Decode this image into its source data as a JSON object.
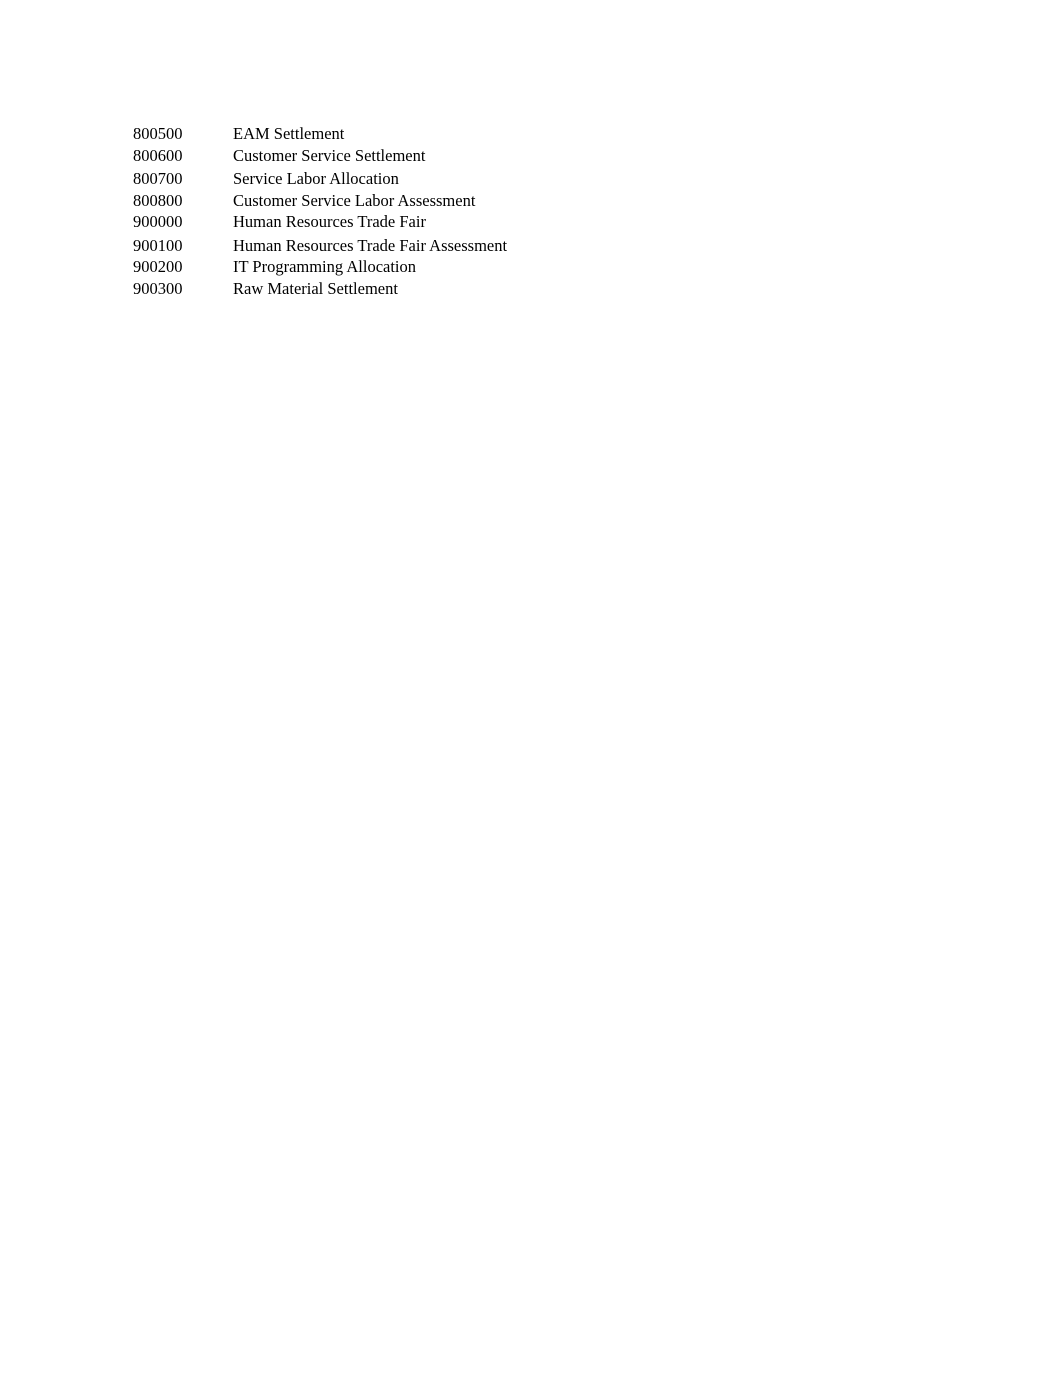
{
  "document": {
    "rows": [
      {
        "code": "800500",
        "description": "EAM Settlement"
      },
      {
        "code": "800600",
        "description": "Customer Service Settlement"
      },
      {
        "code": "800700",
        "description": "Service Labor Allocation"
      },
      {
        "code": "800800",
        "description": "Customer Service Labor Assessment"
      },
      {
        "code": "900000",
        "description": "Human Resources Trade Fair"
      },
      {
        "code": "900100",
        "description": "Human Resources Trade Fair Assessment"
      },
      {
        "code": "900200",
        "description": "IT Programming Allocation"
      },
      {
        "code": "900300",
        "description": "Raw Material Settlement"
      }
    ]
  }
}
